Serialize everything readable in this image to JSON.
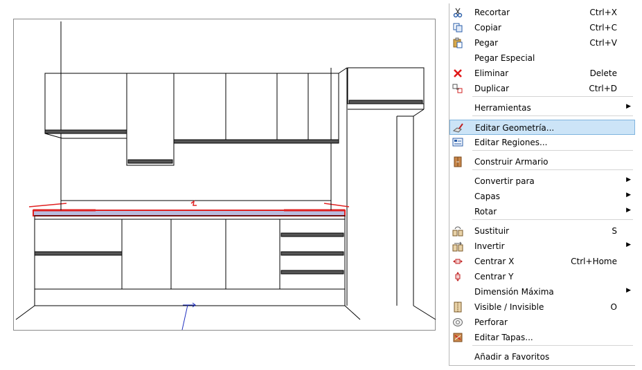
{
  "menu": {
    "items": [
      {
        "label": "Recortar",
        "shortcut": "Ctrl+X",
        "icon": "scissors-icon"
      },
      {
        "label": "Copiar",
        "shortcut": "Ctrl+C",
        "icon": "copy-icon"
      },
      {
        "label": "Pegar",
        "shortcut": "Ctrl+V",
        "icon": "paste-icon"
      },
      {
        "label": "Pegar Especial",
        "shortcut": "",
        "icon": ""
      },
      {
        "label": "Eliminar",
        "shortcut": "Delete",
        "icon": "delete-x-icon"
      },
      {
        "label": "Duplicar",
        "shortcut": "Ctrl+D",
        "icon": "duplicate-icon"
      },
      {
        "label": "Herramientas",
        "shortcut": "",
        "icon": "",
        "submenu": true
      },
      {
        "label": "Editar Geometría...",
        "shortcut": "",
        "icon": "edit-geometry-icon",
        "highlighted": true
      },
      {
        "label": "Editar Regiones...",
        "shortcut": "",
        "icon": "edit-regions-icon"
      },
      {
        "label": "Construir Armario",
        "shortcut": "",
        "icon": "cabinet-icon"
      },
      {
        "label": "Convertir para",
        "shortcut": "",
        "icon": "",
        "submenu": true
      },
      {
        "label": "Capas",
        "shortcut": "",
        "icon": "",
        "submenu": true
      },
      {
        "label": "Rotar",
        "shortcut": "",
        "icon": "",
        "submenu": true
      },
      {
        "label": "Sustituir",
        "shortcut": "S",
        "icon": "substitute-icon"
      },
      {
        "label": "Invertir",
        "shortcut": "",
        "icon": "invert-icon",
        "submenu": true
      },
      {
        "label": "Centrar X",
        "shortcut": "Ctrl+Home",
        "icon": "center-x-icon"
      },
      {
        "label": "Centrar Y",
        "shortcut": "",
        "icon": "center-y-icon"
      },
      {
        "label": "Dimensión Máxima",
        "shortcut": "",
        "icon": "",
        "submenu": true
      },
      {
        "label": "Visible / Invisible",
        "shortcut": "O",
        "icon": "visibility-icon"
      },
      {
        "label": "Perforar",
        "shortcut": "",
        "icon": "drill-icon"
      },
      {
        "label": "Editar Tapas...",
        "shortcut": "",
        "icon": "edit-covers-icon"
      },
      {
        "label": "Añadir a Favoritos",
        "shortcut": "",
        "icon": ""
      }
    ]
  },
  "colors": {
    "highlight_bg": "#cce4f7",
    "highlight_border": "#7fb4de",
    "countertop_red": "#e02020",
    "countertop_fill": "#b8bce0",
    "axis_blue": "#2030c0"
  }
}
